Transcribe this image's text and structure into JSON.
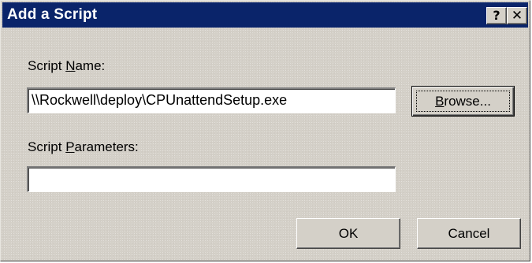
{
  "window": {
    "title": "Add a Script",
    "help_label": "?",
    "close_label": "✕"
  },
  "script_name": {
    "label_prefix": "Script ",
    "label_accel": "N",
    "label_suffix": "ame:",
    "value": "\\\\Rockwell\\deploy\\CPUnattendSetup.exe"
  },
  "browse": {
    "label_accel": "B",
    "label_rest": "rowse..."
  },
  "script_parameters": {
    "label_prefix": "Script ",
    "label_accel": "P",
    "label_suffix": "arameters:",
    "value": ""
  },
  "buttons": {
    "ok": "OK",
    "cancel": "Cancel"
  },
  "colors": {
    "titlebar": "#0a246a",
    "face": "#d4d0c8"
  }
}
